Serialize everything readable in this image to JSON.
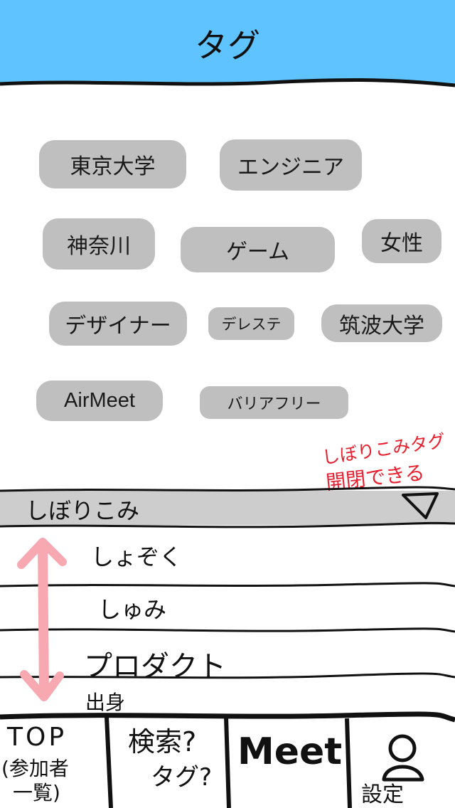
{
  "header": {
    "title": "タグ",
    "background": "#5ec3ff"
  },
  "tags": [
    "東京大学",
    "エンジニア",
    "神奈川",
    "ゲーム",
    "女性",
    "デザイナー",
    "デレステ",
    "筑波大学",
    "AirMeet",
    "バリアフリー"
  ],
  "filter": {
    "label": "しぼりこみ",
    "annotation_line1": "しぼりこみタグ",
    "annotation_line2": "開閉できる",
    "categories": [
      "しょぞく",
      "しゅみ",
      "プロダクト",
      "出身"
    ]
  },
  "tabbar": {
    "top_label": "TOP",
    "top_sub1": "(参加者",
    "top_sub2": "一覧)",
    "search_label": "検索?",
    "search_sub": "タグ?",
    "meet_label": "Meet",
    "settings_label": "設定"
  },
  "colors": {
    "tag_bg": "#bfbfbf",
    "filter_band": "#cdcdcd",
    "annotation": "#e8202f",
    "scroll_arrow": "#f7a8b0"
  },
  "icons": [
    "triangle-down-icon",
    "red-arrow-icon",
    "double-arrow-icon",
    "person-icon"
  ]
}
